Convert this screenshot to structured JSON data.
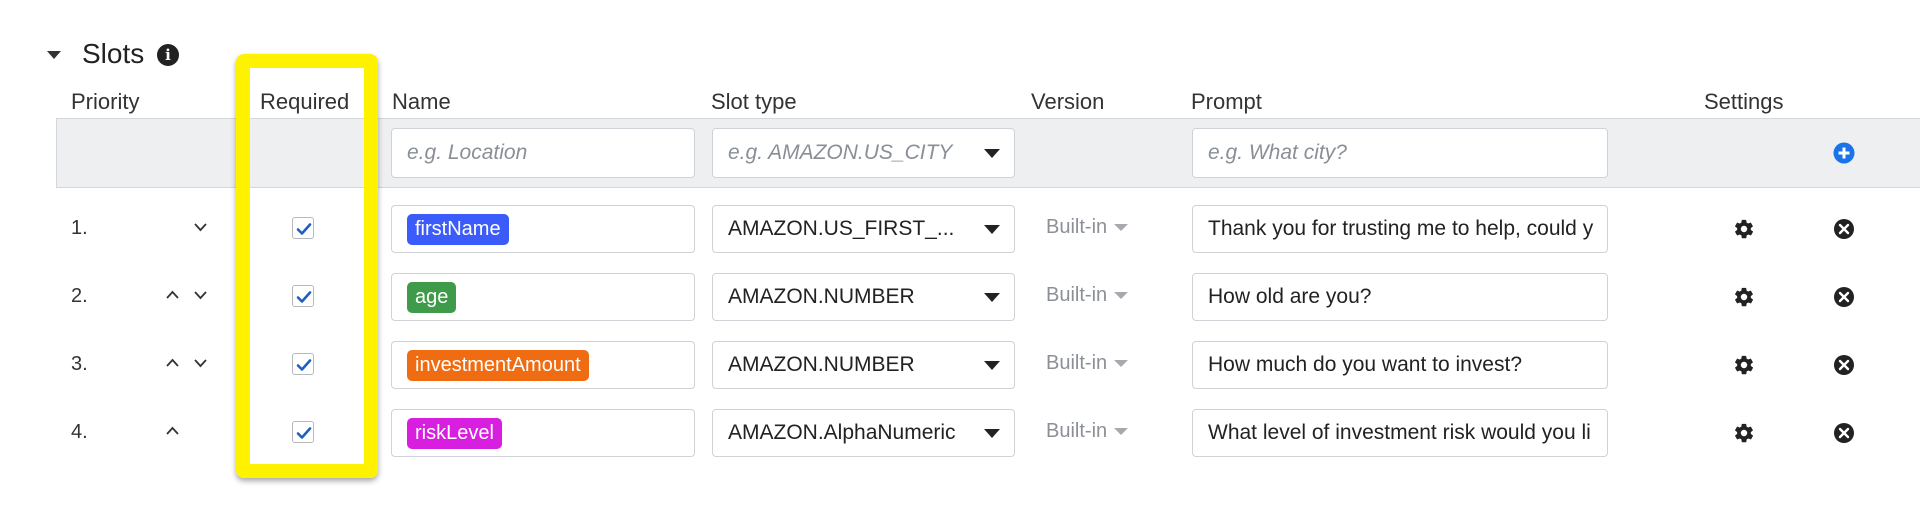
{
  "section": {
    "title": "Slots",
    "info_icon": "info-icon",
    "collapse_icon": "caret-down-icon"
  },
  "columns": {
    "priority": "Priority",
    "required": "Required",
    "name": "Name",
    "slot_type": "Slot type",
    "version": "Version",
    "prompt": "Prompt",
    "settings": "Settings"
  },
  "new_slot": {
    "name_placeholder": "e.g. Location",
    "slot_type_placeholder": "e.g. AMAZON.US_CITY",
    "prompt_placeholder": "e.g. What city?",
    "add_icon": "plus-circle-icon"
  },
  "slots": [
    {
      "priority": "1.",
      "move_up": false,
      "move_down": true,
      "required": true,
      "name": "firstName",
      "name_color": "#3b5bfa",
      "slot_type": "AMAZON.US_FIRST_...",
      "version": "Built-in",
      "prompt": "Thank you for trusting me to help, could y"
    },
    {
      "priority": "2.",
      "move_up": true,
      "move_down": true,
      "required": true,
      "name": "age",
      "name_color": "#3f9a4a",
      "slot_type": "AMAZON.NUMBER",
      "version": "Built-in",
      "prompt": "How old are you?"
    },
    {
      "priority": "3.",
      "move_up": true,
      "move_down": true,
      "required": true,
      "name": "investmentAmount",
      "name_color": "#ef6c12",
      "slot_type": "AMAZON.NUMBER",
      "version": "Built-in",
      "prompt": "How much do you want to invest?"
    },
    {
      "priority": "4.",
      "move_up": true,
      "move_down": false,
      "required": true,
      "name": "riskLevel",
      "name_color": "#d81fe0",
      "slot_type": "AMAZON.AlphaNumeric",
      "version": "Built-in",
      "prompt": "What level of investment risk would you li"
    }
  ],
  "colors": {
    "highlight": "#fff200",
    "checkbox_check": "#1f5fbf",
    "add_icon": "#1a73e8"
  }
}
